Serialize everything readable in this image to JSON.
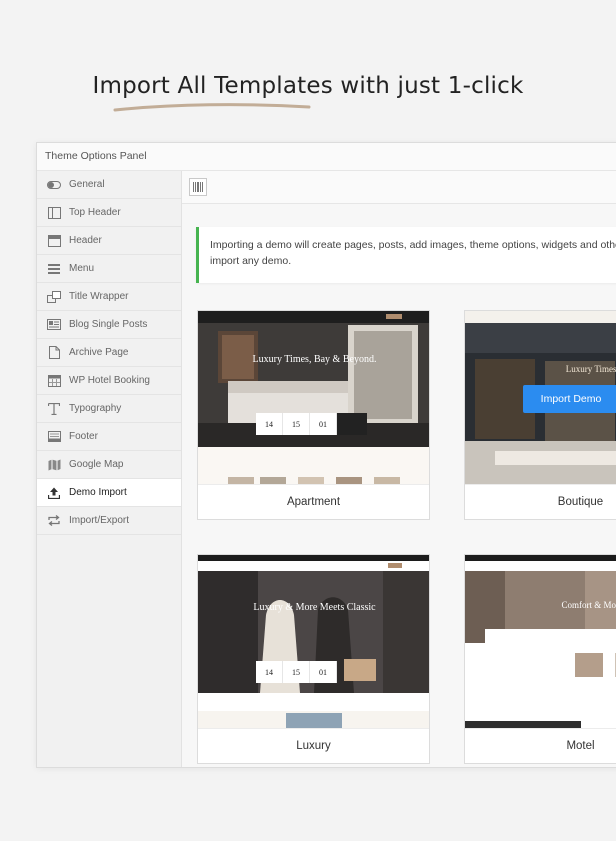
{
  "headline": "Import All Templates with just 1-click",
  "panel": {
    "title": "Theme Options Panel",
    "sidebar": [
      {
        "label": "General",
        "icon": "toggle-icon"
      },
      {
        "label": "Top Header",
        "icon": "top-header-icon"
      },
      {
        "label": "Header",
        "icon": "header-icon"
      },
      {
        "label": "Menu",
        "icon": "menu-icon"
      },
      {
        "label": "Title Wrapper",
        "icon": "title-wrapper-icon"
      },
      {
        "label": "Blog Single Posts",
        "icon": "blog-icon"
      },
      {
        "label": "Archive Page",
        "icon": "archive-icon"
      },
      {
        "label": "WP Hotel Booking",
        "icon": "calendar-icon"
      },
      {
        "label": "Typography",
        "icon": "typography-icon"
      },
      {
        "label": "Footer",
        "icon": "footer-icon"
      },
      {
        "label": "Google Map",
        "icon": "map-icon"
      },
      {
        "label": "Demo Import",
        "icon": "upload-icon"
      },
      {
        "label": "Import/Export",
        "icon": "sync-icon"
      }
    ],
    "active": "Demo Import",
    "notice": {
      "line1": "Importing a demo will create pages, posts, add images, theme options, widgets and othe",
      "line2": "import any demo."
    },
    "demos": [
      {
        "label": "Apartment",
        "hero": "Luxury Times, Bay & Beyond."
      },
      {
        "label": "Boutique",
        "hero": "Luxury Times, Bay & Beyond."
      },
      {
        "label": "Luxury",
        "hero": "Luxury & More Meets Classic"
      },
      {
        "label": "Motel",
        "hero": "Comfort & More Bay & Beyond."
      }
    ],
    "import_button": "Import Demo",
    "booking_dates": [
      "14",
      "15",
      "01"
    ],
    "accent": "#2b8cf0",
    "notice_color": "#46b450"
  }
}
